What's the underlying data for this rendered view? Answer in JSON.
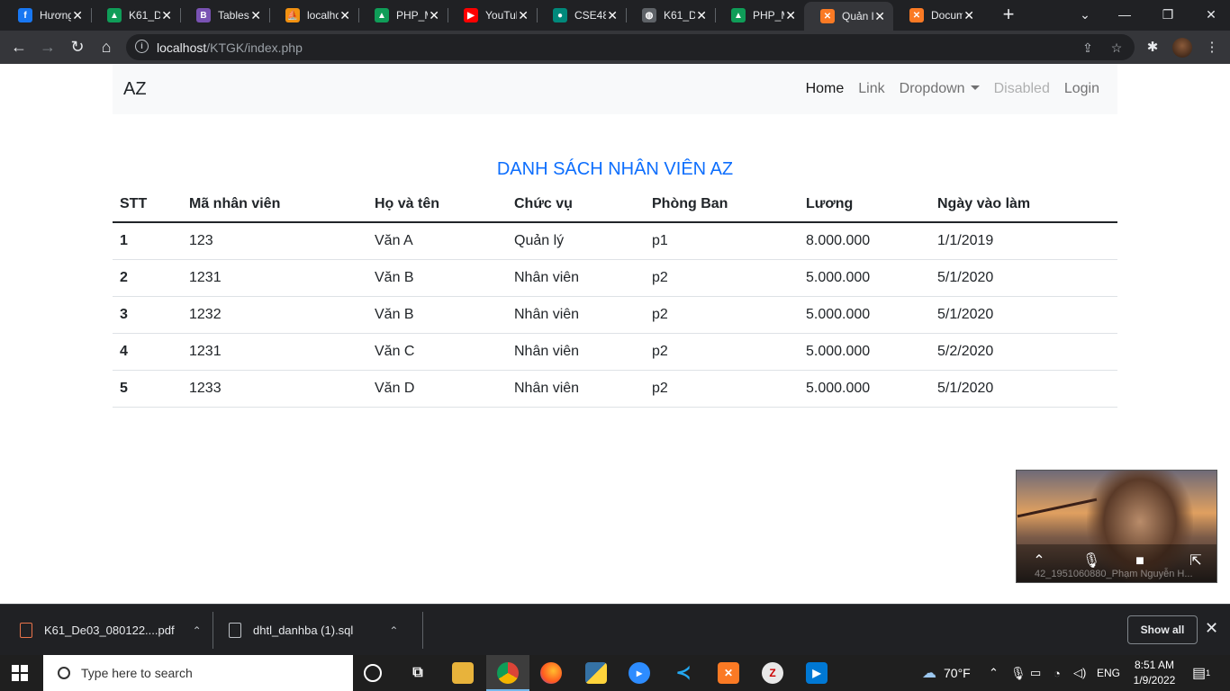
{
  "browser": {
    "tabs": [
      {
        "title": "Hương",
        "favicon": "facebook-icon",
        "color": "#1877f2",
        "glyph": "f"
      },
      {
        "title": "K61_De",
        "favicon": "google-drive-icon",
        "color": "#0f9d58",
        "glyph": "▲"
      },
      {
        "title": "Tables",
        "favicon": "bootstrap-icon",
        "color": "#7952b3",
        "glyph": "B"
      },
      {
        "title": "localho",
        "favicon": "phpmyadmin-icon",
        "color": "#f29111",
        "glyph": "⛵"
      },
      {
        "title": "PHP_M",
        "favicon": "google-drive-icon",
        "color": "#0f9d58",
        "glyph": "▲"
      },
      {
        "title": "YouTub",
        "favicon": "youtube-icon",
        "color": "#ff0000",
        "glyph": "▶"
      },
      {
        "title": "CSE48",
        "favicon": "meet-icon",
        "color": "#00897b",
        "glyph": "●"
      },
      {
        "title": "K61_De",
        "favicon": "globe-icon",
        "color": "#5f6368",
        "glyph": "◍"
      },
      {
        "title": "PHP_M",
        "favicon": "google-drive-icon",
        "color": "#0f9d58",
        "glyph": "▲"
      },
      {
        "title": "Quản l",
        "favicon": "xampp-icon",
        "color": "#fb7a24",
        "glyph": "✕",
        "active": true
      },
      {
        "title": "Docum",
        "favicon": "xampp-icon",
        "color": "#fb7a24",
        "glyph": "✕"
      }
    ],
    "url_host": "localhost",
    "url_path": "/KTGK/index.php"
  },
  "page": {
    "brand": "AZ",
    "nav": {
      "home": "Home",
      "link": "Link",
      "dropdown": "Dropdown",
      "disabled": "Disabled",
      "login": "Login"
    },
    "heading": "DANH SÁCH NHÂN VIÊN AZ",
    "table": {
      "headers": [
        "STT",
        "Mã nhân viên",
        "Họ và tên",
        "Chức vụ",
        "Phòng Ban",
        "Lương",
        "Ngày vào làm"
      ],
      "rows": [
        [
          "1",
          "123",
          "Văn A",
          "Quản lý",
          "p1",
          "8.000.000",
          "1/1/2019"
        ],
        [
          "2",
          "1231",
          "Văn B",
          "Nhân viên",
          "p2",
          "5.000.000",
          "5/1/2020"
        ],
        [
          "3",
          "1232",
          "Văn B",
          "Nhân viên",
          "p2",
          "5.000.000",
          "5/1/2020"
        ],
        [
          "4",
          "1231",
          "Văn C",
          "Nhân viên",
          "p2",
          "5.000.000",
          "5/2/2020"
        ],
        [
          "5",
          "1233",
          "Văn D",
          "Nhân viên",
          "p2",
          "5.000.000",
          "5/1/2020"
        ]
      ]
    }
  },
  "video": {
    "participant": "42_1951060880_Phạm Nguyễn H..."
  },
  "downloads": {
    "items": [
      {
        "name": "K61_De03_080122....pdf",
        "icon": "pdf-file-icon"
      },
      {
        "name": "dhtl_danhba (1).sql",
        "icon": "sql-file-icon"
      }
    ],
    "show_all": "Show all"
  },
  "taskbar": {
    "search_placeholder": "Type here to search",
    "weather": "70°F",
    "language": "ENG",
    "time": "8:51 AM",
    "date": "1/9/2022",
    "notification_count": "1"
  }
}
